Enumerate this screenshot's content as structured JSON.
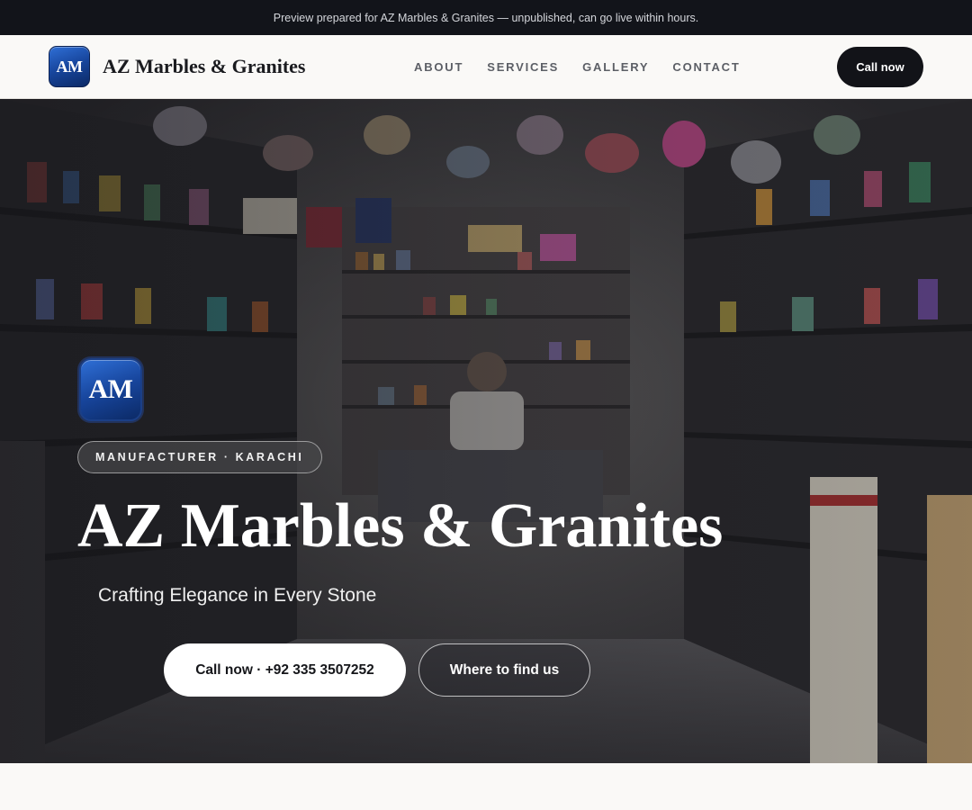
{
  "banner": {
    "text": "Preview prepared for AZ Marbles & Granites — unpublished, can go live within hours."
  },
  "header": {
    "logo_text": "AM",
    "brand_name": "AZ Marbles & Granites",
    "nav": [
      {
        "label": "ABOUT"
      },
      {
        "label": "SERVICES"
      },
      {
        "label": "GALLERY"
      },
      {
        "label": "CONTACT"
      }
    ],
    "cta_label": "Call now"
  },
  "hero": {
    "logo_text": "AM",
    "badge": "MANUFACTURER · KARACHI",
    "title": "AZ Marbles & Granites",
    "subtitle": "Crafting Elegance in Every Stone",
    "primary_button": "Call now · +92 335 3507252",
    "secondary_button": "Where to find us",
    "background_image": "shop interior with shelves of goods and a shopkeeper at the counter"
  },
  "colors": {
    "banner_bg": "#12141a",
    "header_bg": "#faf9f7",
    "dark_button": "#121318",
    "logo_blue": "#17459c"
  }
}
